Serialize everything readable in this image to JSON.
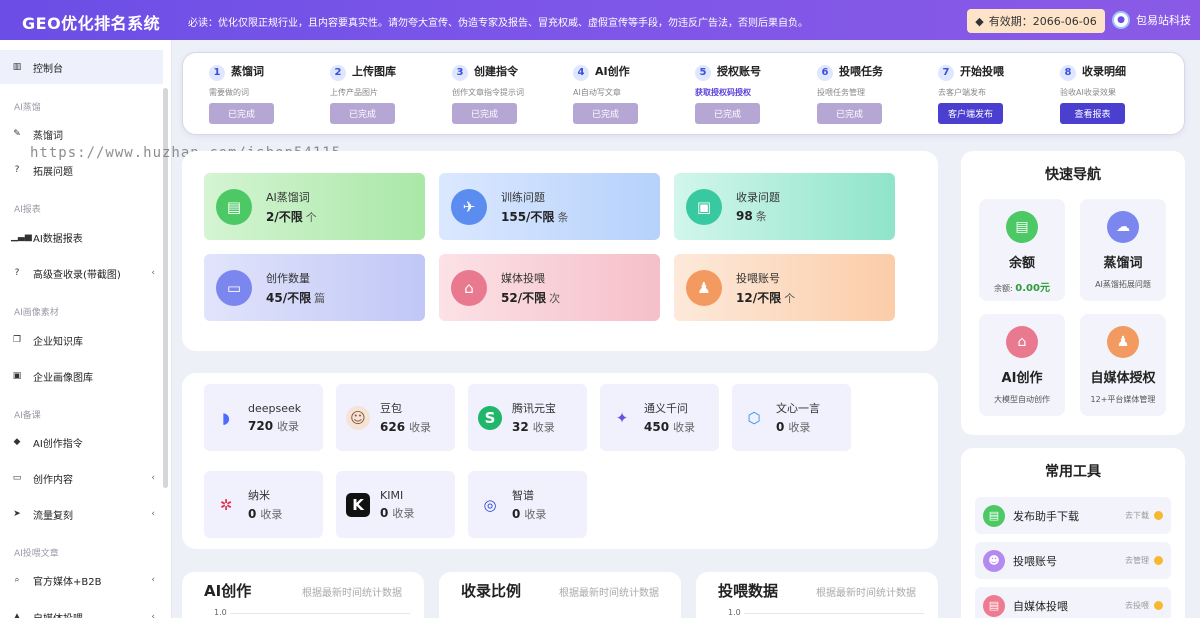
{
  "header": {
    "brand": "GEO优化排名系统",
    "notice": "必读：优化仅限正规行业，且内容要真实性。请勿夸大宣传、伪造专家及报告、冒充权威、虚假宣传等手段，勿违反广告法，否则后果自负。",
    "expire_label": "有效期：2066-06-06",
    "username": "包易站科技"
  },
  "sidebar": {
    "items": [
      {
        "label": "控制台",
        "icon": "chart-bar-icon"
      },
      {
        "label": "蒸馏词",
        "icon": "pin-icon"
      },
      {
        "label": "拓展问题",
        "icon": "question-icon"
      },
      {
        "label": "AI数据报表",
        "icon": "signal-icon"
      },
      {
        "label": "高级查收录(带截图)",
        "icon": "question-icon"
      },
      {
        "label": "企业知识库",
        "icon": "copy-icon"
      },
      {
        "label": "企业画像图库",
        "icon": "image-icon"
      },
      {
        "label": "AI创作指令",
        "icon": "tag-icon"
      },
      {
        "label": "创作内容",
        "icon": "folder-icon"
      },
      {
        "label": "流量复刻",
        "icon": "rocket-icon"
      },
      {
        "label": "官方媒体+B2B",
        "icon": "search-icon"
      },
      {
        "label": "自媒体投喂",
        "icon": "send-icon"
      }
    ],
    "groups": [
      "AI蒸馏",
      "AI报表",
      "AI画像素材",
      "AI备课",
      "AI投喂文章"
    ],
    "watermark": "https://www.huzhan.com/ishop54115"
  },
  "steps": [
    {
      "num": "1",
      "title": "蒸馏词",
      "sub": "需要做的词",
      "btn": "已完成"
    },
    {
      "num": "2",
      "title": "上传图库",
      "sub": "上传产品图片",
      "btn": "已完成"
    },
    {
      "num": "3",
      "title": "创建指令",
      "sub": "创作文章指令提示词",
      "btn": "已完成"
    },
    {
      "num": "4",
      "title": "AI创作",
      "sub": "AI自动写文章",
      "btn": "已完成"
    },
    {
      "num": "5",
      "title": "授权账号",
      "sub": "获取授权码授权",
      "btn": "已完成"
    },
    {
      "num": "6",
      "title": "投喂任务",
      "sub": "投喂任务管理",
      "btn": "已完成"
    },
    {
      "num": "7",
      "title": "开始投喂",
      "sub": "去客户端发布",
      "btn": "客户端发布"
    },
    {
      "num": "8",
      "title": "收录明细",
      "sub": "验收AI收录效果",
      "btn": "查看报表"
    }
  ],
  "stats": [
    {
      "label": "AI蒸馏词",
      "value": "2/不限",
      "unit": "个",
      "icon": "clipboard-icon"
    },
    {
      "label": "训练问题",
      "value": "155/不限",
      "unit": "条",
      "icon": "compass-icon"
    },
    {
      "label": "收录问题",
      "value": "98",
      "unit": "条",
      "icon": "wallet-icon"
    },
    {
      "label": "创作数量",
      "value": "45/不限",
      "unit": "篇",
      "icon": "folder-icon"
    },
    {
      "label": "媒体投喂",
      "value": "52/不限",
      "unit": "次",
      "icon": "basket-icon"
    },
    {
      "label": "投喂账号",
      "value": "12/不限",
      "unit": "个",
      "icon": "stamp-icon"
    }
  ],
  "ai_models": [
    {
      "name": "deepseek",
      "count": "720",
      "unit": "收录",
      "icon": "whale-icon"
    },
    {
      "name": "豆包",
      "count": "626",
      "unit": "收录",
      "icon": "doubao-icon"
    },
    {
      "name": "腾讯元宝",
      "count": "32",
      "unit": "收录",
      "icon": "yuanbao-icon"
    },
    {
      "name": "通义千问",
      "count": "450",
      "unit": "收录",
      "icon": "qianwen-icon"
    },
    {
      "name": "文心一言",
      "count": "0",
      "unit": "收录",
      "icon": "wenxin-icon"
    },
    {
      "name": "纳米",
      "count": "0",
      "unit": "收录",
      "icon": "nami-icon"
    },
    {
      "name": "KIMI",
      "count": "0",
      "unit": "收录",
      "icon": "kimi-icon"
    },
    {
      "name": "智谱",
      "count": "0",
      "unit": "收录",
      "icon": "zhipu-icon"
    }
  ],
  "charts": [
    {
      "title": "AI创作",
      "subtitle": "根据最新时间统计数据",
      "tick": "1.0"
    },
    {
      "title": "收录比例",
      "subtitle": "根据最新时间统计数据",
      "tick": ""
    },
    {
      "title": "投喂数据",
      "subtitle": "根据最新时间统计数据",
      "tick": "1.0"
    }
  ],
  "quick_nav": {
    "title": "快速导航",
    "cards": [
      {
        "title": "余额",
        "sub_prefix": "余额:",
        "sub_value": "0.00元",
        "icon": "clipboard-icon"
      },
      {
        "title": "蒸馏词",
        "sub": "AI蒸馏拓展问题",
        "icon": "cloud-icon"
      },
      {
        "title": "AI创作",
        "sub": "大模型自动创作",
        "icon": "basket-icon"
      },
      {
        "title": "自媒体授权",
        "sub": "12+平台媒体管理",
        "icon": "stamp-icon"
      }
    ]
  },
  "tools": {
    "title": "常用工具",
    "rows": [
      {
        "label": "发布助手下载",
        "action": "去下载",
        "icon": "download-icon"
      },
      {
        "label": "投喂账号",
        "action": "去管理",
        "icon": "user-icon"
      },
      {
        "label": "自媒体投喂",
        "action": "去投喂",
        "icon": "media-icon"
      }
    ]
  }
}
